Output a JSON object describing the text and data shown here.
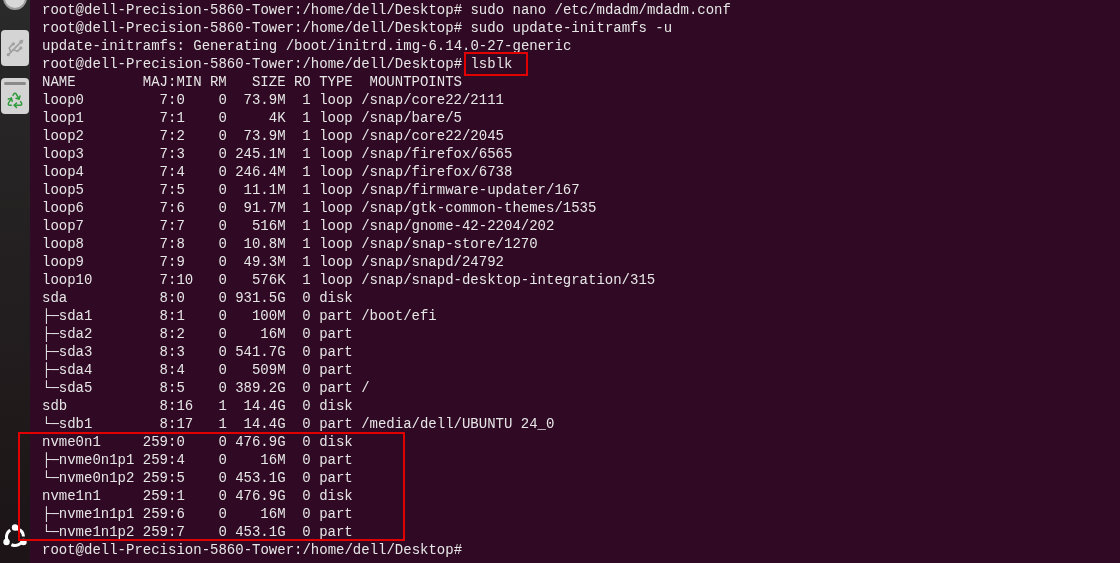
{
  "terminal": {
    "lines": [
      {
        "kind": "prompt",
        "prompt": "root@dell-Precision-5860-Tower:/home/dell/Desktop#",
        "command": "sudo nano /etc/mdadm/mdadm.conf",
        "highlighted": false
      },
      {
        "kind": "prompt",
        "prompt": "root@dell-Precision-5860-Tower:/home/dell/Desktop#",
        "command": "sudo update-initramfs -u",
        "highlighted": false
      },
      {
        "kind": "output",
        "text": "update-initramfs: Generating /boot/initrd.img-6.14.0-27-generic"
      },
      {
        "kind": "prompt",
        "prompt": "root@dell-Precision-5860-Tower:/home/dell/Desktop#",
        "command": "lsblk",
        "highlighted": true
      }
    ],
    "lsblk": {
      "columns": [
        "NAME",
        "MAJ:MIN",
        "RM",
        "SIZE",
        "RO",
        "TYPE",
        "MOUNTPOINTS"
      ],
      "groups": [
        {
          "highlighted": false,
          "rows": [
            {
              "name": "loop0",
              "majmin": "7:0",
              "rm": "0",
              "size": "73.9M",
              "ro": "1",
              "type": "loop",
              "mount": "/snap/core22/2111"
            },
            {
              "name": "loop1",
              "majmin": "7:1",
              "rm": "0",
              "size": "4K",
              "ro": "1",
              "type": "loop",
              "mount": "/snap/bare/5"
            },
            {
              "name": "loop2",
              "majmin": "7:2",
              "rm": "0",
              "size": "73.9M",
              "ro": "1",
              "type": "loop",
              "mount": "/snap/core22/2045"
            },
            {
              "name": "loop3",
              "majmin": "7:3",
              "rm": "0",
              "size": "245.1M",
              "ro": "1",
              "type": "loop",
              "mount": "/snap/firefox/6565"
            },
            {
              "name": "loop4",
              "majmin": "7:4",
              "rm": "0",
              "size": "246.4M",
              "ro": "1",
              "type": "loop",
              "mount": "/snap/firefox/6738"
            },
            {
              "name": "loop5",
              "majmin": "7:5",
              "rm": "0",
              "size": "11.1M",
              "ro": "1",
              "type": "loop",
              "mount": "/snap/firmware-updater/167"
            },
            {
              "name": "loop6",
              "majmin": "7:6",
              "rm": "0",
              "size": "91.7M",
              "ro": "1",
              "type": "loop",
              "mount": "/snap/gtk-common-themes/1535"
            },
            {
              "name": "loop7",
              "majmin": "7:7",
              "rm": "0",
              "size": "516M",
              "ro": "1",
              "type": "loop",
              "mount": "/snap/gnome-42-2204/202"
            },
            {
              "name": "loop8",
              "majmin": "7:8",
              "rm": "0",
              "size": "10.8M",
              "ro": "1",
              "type": "loop",
              "mount": "/snap/snap-store/1270"
            },
            {
              "name": "loop9",
              "majmin": "7:9",
              "rm": "0",
              "size": "49.3M",
              "ro": "1",
              "type": "loop",
              "mount": "/snap/snapd/24792"
            },
            {
              "name": "loop10",
              "majmin": "7:10",
              "rm": "0",
              "size": "576K",
              "ro": "1",
              "type": "loop",
              "mount": "/snap/snapd-desktop-integration/315"
            },
            {
              "name": "sda",
              "majmin": "8:0",
              "rm": "0",
              "size": "931.5G",
              "ro": "0",
              "type": "disk",
              "children": [
                {
                  "name": "├─sda1",
                  "majmin": "8:1",
                  "rm": "0",
                  "size": "100M",
                  "ro": "0",
                  "type": "part",
                  "mount": "/boot/efi"
                },
                {
                  "name": "├─sda2",
                  "majmin": "8:2",
                  "rm": "0",
                  "size": "16M",
                  "ro": "0",
                  "type": "part"
                },
                {
                  "name": "├─sda3",
                  "majmin": "8:3",
                  "rm": "0",
                  "size": "541.7G",
                  "ro": "0",
                  "type": "part"
                },
                {
                  "name": "├─sda4",
                  "majmin": "8:4",
                  "rm": "0",
                  "size": "509M",
                  "ro": "0",
                  "type": "part"
                },
                {
                  "name": "└─sda5",
                  "majmin": "8:5",
                  "rm": "0",
                  "size": "389.2G",
                  "ro": "0",
                  "type": "part",
                  "mount": "/"
                }
              ]
            },
            {
              "name": "sdb",
              "majmin": "8:16",
              "rm": "1",
              "size": "14.4G",
              "ro": "0",
              "type": "disk",
              "children": [
                {
                  "name": "└─sdb1",
                  "majmin": "8:17",
                  "rm": "1",
                  "size": "14.4G",
                  "ro": "0",
                  "type": "part",
                  "mount": "/media/dell/UBUNTU 24_0"
                }
              ]
            }
          ]
        },
        {
          "highlighted": true,
          "rows": [
            {
              "name": "nvme0n1",
              "majmin": "259:0",
              "rm": "0",
              "size": "476.9G",
              "ro": "0",
              "type": "disk",
              "children": [
                {
                  "name": "├─nvme0n1p1",
                  "majmin": "259:4",
                  "rm": "0",
                  "size": "16M",
                  "ro": "0",
                  "type": "part"
                },
                {
                  "name": "└─nvme0n1p2",
                  "majmin": "259:5",
                  "rm": "0",
                  "size": "453.1G",
                  "ro": "0",
                  "type": "part"
                }
              ]
            },
            {
              "name": "nvme1n1",
              "majmin": "259:1",
              "rm": "0",
              "size": "476.9G",
              "ro": "0",
              "type": "disk",
              "children": [
                {
                  "name": "├─nvme1n1p1",
                  "majmin": "259:6",
                  "rm": "0",
                  "size": "16M",
                  "ro": "0",
                  "type": "part"
                },
                {
                  "name": "└─nvme1n1p2",
                  "majmin": "259:7",
                  "rm": "0",
                  "size": "453.1G",
                  "ro": "0",
                  "type": "part"
                }
              ]
            }
          ]
        }
      ]
    },
    "final_prompt": "root@dell-Precision-5860-Tower:/home/dell/Desktop#"
  }
}
